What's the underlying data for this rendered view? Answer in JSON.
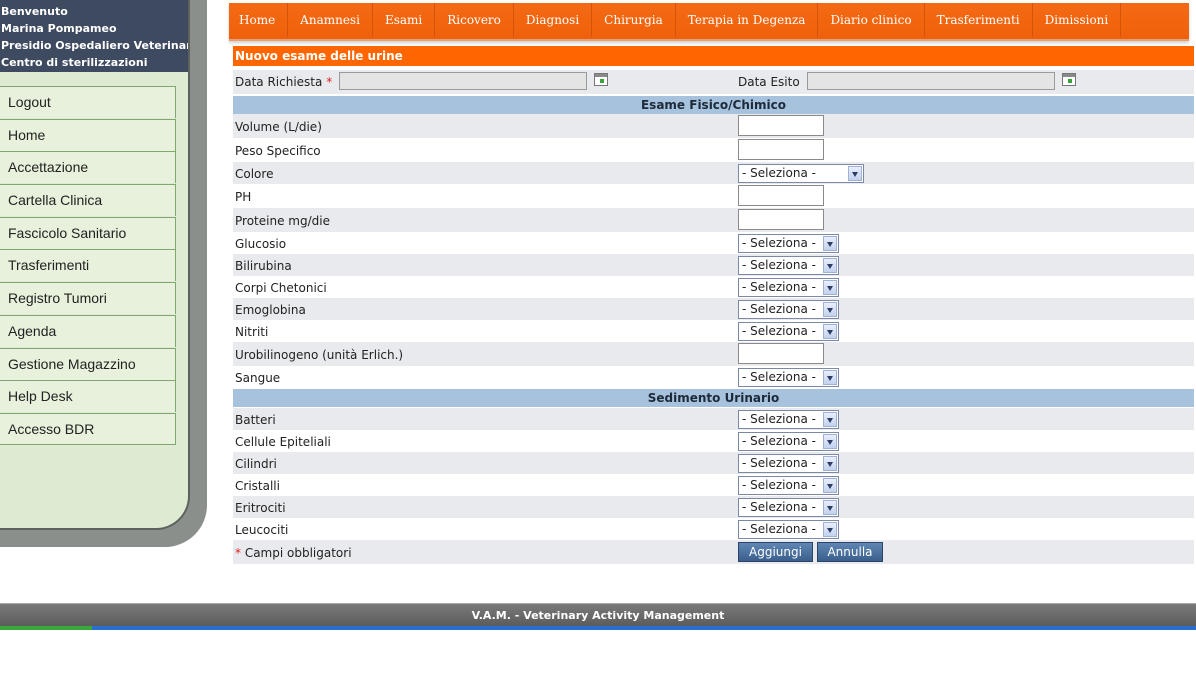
{
  "sidebar": {
    "welcome": [
      "Benvenuto",
      "Marina Pompameo",
      "Presidio Ospedaliero Veterinario",
      "Centro di sterilizzazioni"
    ],
    "items": [
      "Logout",
      "Home",
      "Accettazione",
      "Cartella Clinica",
      "Fascicolo Sanitario",
      "Trasferimenti",
      "Registro Tumori",
      "Agenda",
      "Gestione Magazzino",
      "Help Desk",
      "Accesso BDR"
    ]
  },
  "nav": {
    "tabs": [
      "Home",
      "Anamnesi",
      "Esami",
      "Ricovero",
      "Diagnosi",
      "Chirurgia",
      "Terapia in Degenza",
      "Diario clinico",
      "Trasferimenti",
      "Dimissioni"
    ]
  },
  "form": {
    "title": "Nuovo esame delle urine",
    "date_request_label": "Data Richiesta",
    "required_mark": "*",
    "date_result_label": "Data Esito",
    "section_physical": "Esame Fisico/Chimico",
    "section_sediment": "Sedimento Urinario",
    "select_placeholder": "- Seleziona -",
    "fields": {
      "volume": "Volume (L/die)",
      "peso": "Peso Specifico",
      "colore": "Colore",
      "ph": "PH",
      "proteine": "Proteine mg/die",
      "glucosio": "Glucosio",
      "bilirubina": "Bilirubina",
      "corpi": "Corpi Chetonici",
      "emoglobina": "Emoglobina",
      "nitriti": "Nitriti",
      "urobilinogeno": "Urobilinogeno (unità Erlich.)",
      "sangue": "Sangue",
      "batteri": "Batteri",
      "cellule": "Cellule Epiteliali",
      "cilindri": "Cilindri",
      "cristalli": "Cristalli",
      "eritrociti": "Eritrociti",
      "leucociti": "Leucociti"
    },
    "required_note": "Campi obbligatori",
    "add_button": "Aggiungi",
    "cancel_button": "Annulla"
  },
  "footer": "V.A.M. - Veterinary Activity Management"
}
